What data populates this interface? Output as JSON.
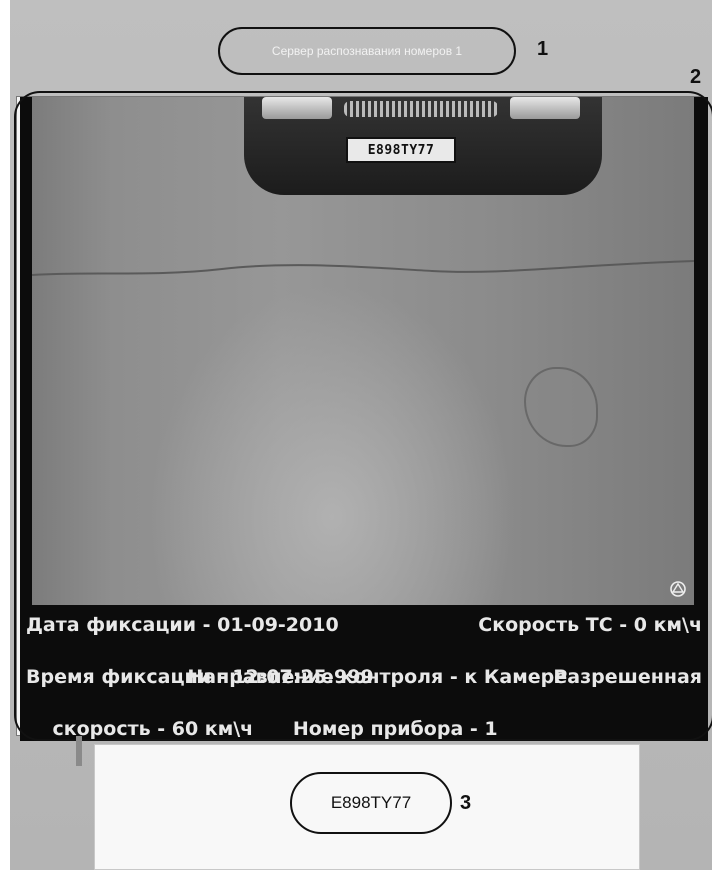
{
  "header": {
    "server_title": "Сервер распознавания номеров 1"
  },
  "callouts": {
    "one": "1",
    "two": "2",
    "three": "3"
  },
  "video": {
    "plate_in_image": "E898TY77",
    "overlay": {
      "line1_left": "Дата фиксации - 01-09-2010",
      "line1_right": "Скорость ТС - 0 км\\ч",
      "line2": "Направление контроля - к Камере",
      "line3_left": "Время фиксации - 12:07:25.999",
      "line3_right": "Разрешенная",
      "line4_left": "скорость - 60 км\\ч",
      "line4_right": "Номер прибора - 1"
    }
  },
  "recognized": {
    "plate_number": "E898TY77"
  },
  "icons": {
    "camera_logo": "camera-logo-icon"
  },
  "colors": {
    "window_bg": "#bfbfbf",
    "video_bg": "#0c0c0c",
    "overlay_text": "#e8e8e8",
    "annotation": "#111111"
  }
}
